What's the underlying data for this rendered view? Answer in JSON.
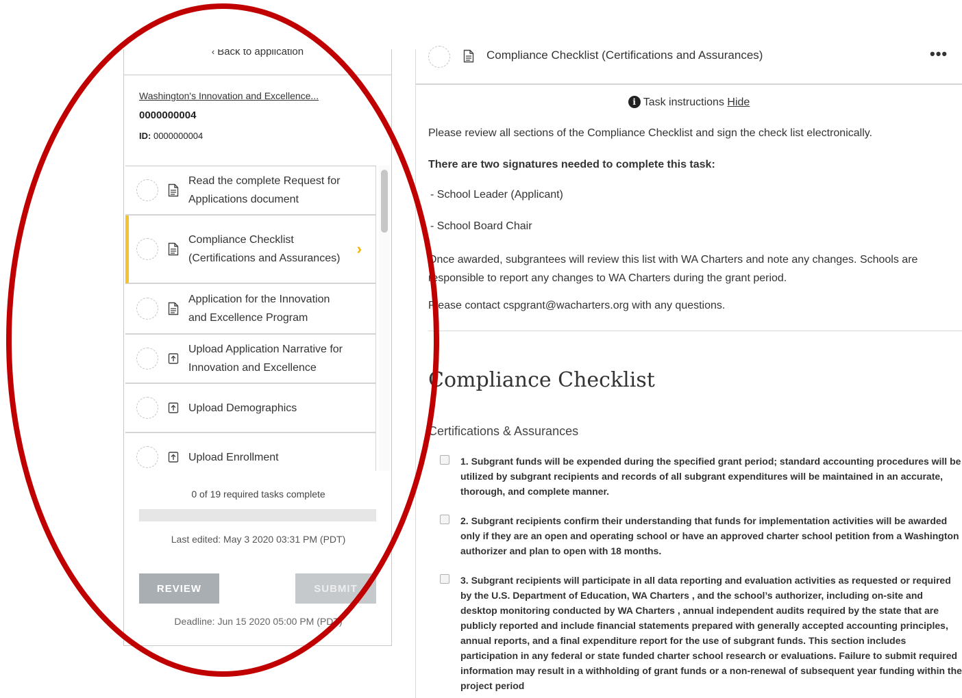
{
  "left": {
    "back_label": "Back to application",
    "app_name": "Washington's Innovation and Excellence...",
    "app_number": "0000000004",
    "id_label": "ID:",
    "id_value": "0000000004",
    "tasks": [
      {
        "label": "Read the complete Request for Applications document",
        "icon": "document-icon",
        "active": false
      },
      {
        "label": "Compliance Checklist (Certifications and Assurances)",
        "icon": "document-icon",
        "active": true
      },
      {
        "label": "Application for the Innovation and Excellence Program",
        "icon": "document-icon",
        "active": false
      },
      {
        "label": "Upload Application Narrative for Innovation and Excellence",
        "icon": "upload-icon",
        "active": false
      },
      {
        "label": "Upload Demographics",
        "icon": "upload-icon",
        "active": false
      },
      {
        "label": "Upload Enrollment",
        "icon": "upload-icon",
        "active": false
      }
    ],
    "progress_text": "0 of 19 required tasks complete",
    "progress_fraction": 0,
    "last_edited": "Last edited: May 3 2020 03:31 PM (PDT)",
    "review_label": "REVIEW",
    "submit_label": "SUBMIT",
    "deadline": "Deadline: Jun 15 2020 05:00 PM (PDT)"
  },
  "right": {
    "header_title": "Compliance Checklist (Certifications and Assurances)",
    "more_label": "•••",
    "instructions_label": "Task instructions",
    "hide_label": "Hide",
    "intro": "Please review all sections of the Compliance Checklist and sign the check list electronically.",
    "signatures_heading": "There are two signatures needed to complete this task:",
    "signature_1": " - School Leader (Applicant)",
    "signature_2": " - School Board Chair",
    "awarded_text": "Once awarded, subgrantees will review this list with WA Charters and note any changes. Schools are responsible to report any changes to WA Charters during the grant period.",
    "contact_text": "Please contact cspgrant@wacharters.org with any questions.",
    "section_title": "Compliance Checklist",
    "section_subtitle": "Certifications & Assurances",
    "checklist": [
      {
        "text": "1. Subgrant funds will be expended during the specified grant period; standard accounting procedures will be utilized by subgrant recipients and records of all subgrant expenditures will be maintained in an accurate, thorough, and complete manner."
      },
      {
        "text": "2. Subgrant recipients confirm their understanding that funds for implementation activities will be awarded only if they are an open and operating school or have an approved charter school petition from a Washington authorizer and plan to open with 18 months."
      },
      {
        "text": "3. Subgrant recipients will participate in all data reporting and evaluation activities as requested or required by the U.S. Department of Education, WA Charters , and the school’s authorizer, including on-site and desktop monitoring conducted by WA Charters , annual independent audits required by the state that are publicly reported and include financial statements prepared with generally accepted accounting principles, annual reports, and a final expenditure report for the use of subgrant funds. This section includes participation in any federal or state funded charter school research or evaluations. Failure to submit required information may result in a withholding of grant funds or a non-renewal of subsequent year funding within the project period"
      }
    ]
  },
  "colors": {
    "accent_yellow": "#f2c230",
    "annotation_red": "#c00000",
    "button_gray": "#a9aeb2"
  }
}
